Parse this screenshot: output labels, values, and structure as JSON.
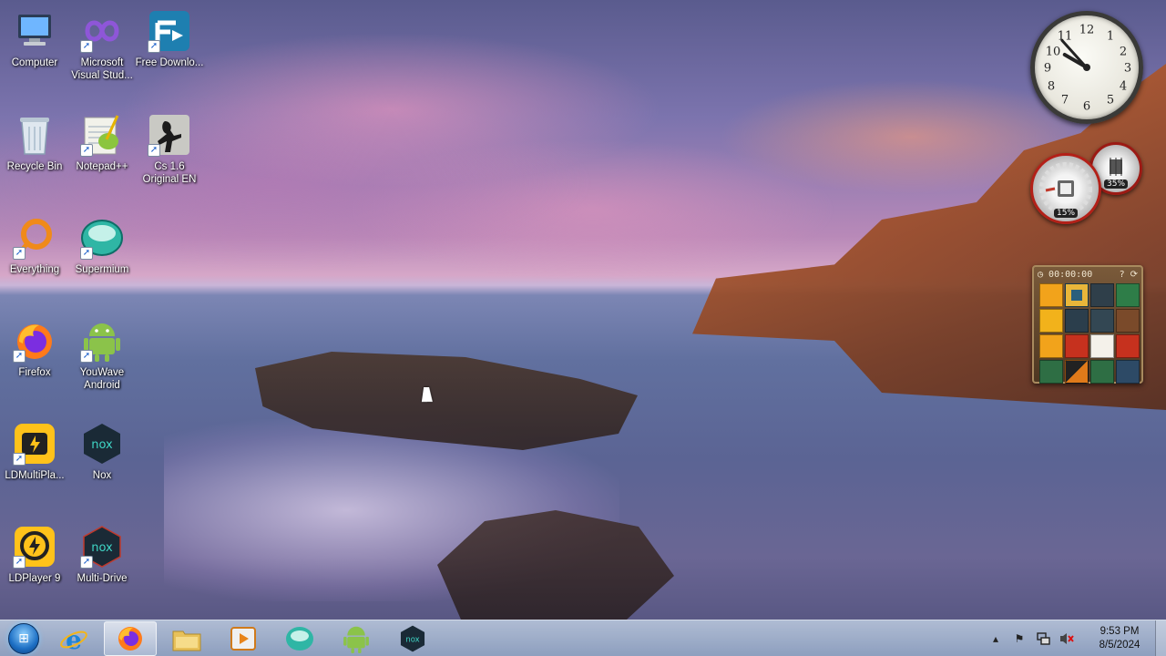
{
  "desktop": {
    "icons": [
      {
        "label": "Computer"
      },
      {
        "label": "Microsoft Visual Stud..."
      },
      {
        "label": "Free Downlo..."
      },
      {
        "label": "Recycle Bin"
      },
      {
        "label": "Notepad++"
      },
      {
        "label": "Cs 1.6 Original EN"
      },
      {
        "label": "Everything"
      },
      {
        "label": "Supermium"
      },
      {
        "label": "Firefox"
      },
      {
        "label": "YouWave Android"
      },
      {
        "label": "LDMultiPla..."
      },
      {
        "label": "Nox"
      },
      {
        "label": "LDPlayer 9"
      },
      {
        "label": "Multi-Drive"
      }
    ]
  },
  "gadgets": {
    "clock": {
      "numerals": [
        "12",
        "1",
        "2",
        "3",
        "4",
        "5",
        "6",
        "7",
        "8",
        "9",
        "10",
        "11"
      ]
    },
    "cpu_meter": {
      "cpu": "15%",
      "memory": "35%"
    },
    "puzzle": {
      "timer": "00:00:00"
    }
  },
  "taskbar": {
    "apps": [
      "internet-explorer-icon",
      "firefox-icon",
      "file-explorer-icon",
      "media-player-icon",
      "supermium-icon",
      "android-icon",
      "nox-icon"
    ],
    "active_app": "firefox-icon",
    "clock": {
      "time": "9:53 PM",
      "date": "8/5/2024"
    }
  },
  "colors": {
    "accent": "#1d6fc4",
    "meter_ring": "#b32018"
  }
}
